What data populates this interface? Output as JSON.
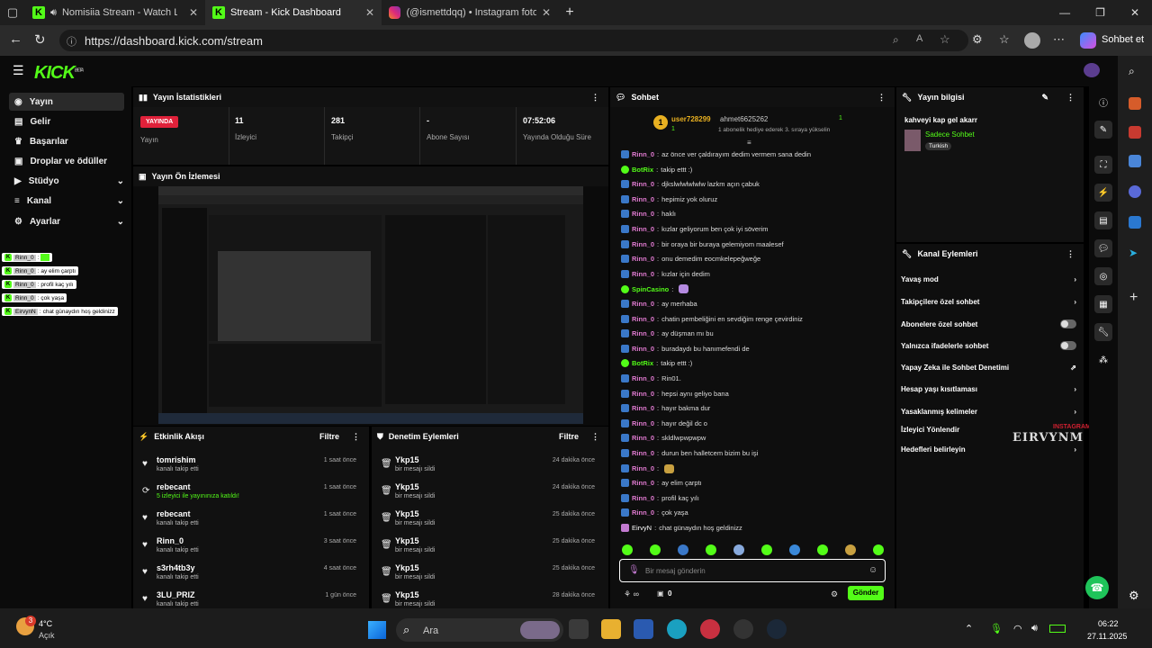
{
  "browser": {
    "tabs": [
      {
        "title": "Nomisiia Stream - Watch Liv",
        "active": false
      },
      {
        "title": "Stream - Kick Dashboard",
        "active": true
      },
      {
        "title": "(@ismettdqq) • Instagram fotoğra",
        "active": false
      }
    ],
    "url": "https://dashboard.kick.com/stream",
    "copilot_label": "Sohbet et"
  },
  "app": {
    "logo": "KICK",
    "logo_sup": "BETA"
  },
  "sidebar": {
    "items": [
      {
        "label": "Yayın",
        "icon": "broadcast-icon",
        "active": true
      },
      {
        "label": "Gelir",
        "icon": "money-icon"
      },
      {
        "label": "Başarılar",
        "icon": "trophy-icon"
      },
      {
        "label": "Droplar ve ödüller",
        "icon": "gift-icon"
      },
      {
        "label": "Stüdyo",
        "icon": "video-icon",
        "expand": true
      },
      {
        "label": "Kanal",
        "icon": "list-icon",
        "expand": true
      },
      {
        "label": "Ayarlar",
        "icon": "gear-icon",
        "expand": true
      }
    ],
    "overlay_chat": [
      {
        "user": "Rinn_0",
        "text": ""
      },
      {
        "user": "Rinn_0",
        "text": "ay elim çarptı"
      },
      {
        "user": "Rinn_0",
        "text": "profil kaç yılı"
      },
      {
        "user": "Rinn_0",
        "text": "çok yaşa"
      },
      {
        "user": "EirvynN",
        "text": "chat günaydın hoş geldinizz"
      }
    ]
  },
  "stats": {
    "title": "Yayın İstatistikleri",
    "live_badge": "YAYINDA",
    "live_label": "Yayın",
    "items": [
      {
        "value": "11",
        "label": "İzleyici"
      },
      {
        "value": "281",
        "label": "Takipçi"
      },
      {
        "value": "-",
        "label": "Abone Sayısı"
      },
      {
        "value": "07:52:06",
        "label": "Yayında Olduğu Süre"
      }
    ]
  },
  "preview": {
    "title": "Yayın Ön İzlemesi"
  },
  "activity": {
    "title": "Etkinlik Akışı",
    "filter": "Filtre",
    "events": [
      {
        "name": "tomrishim",
        "sub": "kanalı takip etti",
        "time": "1 saat önce",
        "icon": "heart-icon"
      },
      {
        "name": "rebecant",
        "sub": "5 izleyici ile yayınınıza katıldı!",
        "time": "1 saat önce",
        "icon": "raid-icon"
      },
      {
        "name": "rebecant",
        "sub": "kanalı takip etti",
        "time": "1 saat önce",
        "icon": "heart-icon"
      },
      {
        "name": "Rinn_0",
        "sub": "kanalı takip etti",
        "time": "3 saat önce",
        "icon": "heart-icon"
      },
      {
        "name": "s3rh4tb3y",
        "sub": "kanalı takip etti",
        "time": "4 saat önce",
        "icon": "heart-icon"
      },
      {
        "name": "3LU_PRIZ",
        "sub": "kanalı takip etti",
        "time": "1 gün önce",
        "icon": "heart-icon"
      }
    ]
  },
  "moderation": {
    "title": "Denetim Eylemleri",
    "filter": "Filtre",
    "events": [
      {
        "name": "Ykp15",
        "sub": "bir mesajı sildi",
        "time": "24 dakika önce"
      },
      {
        "name": "Ykp15",
        "sub": "bir mesajı sildi",
        "time": "24 dakika önce"
      },
      {
        "name": "Ykp15",
        "sub": "bir mesajı sildi",
        "time": "25 dakika önce"
      },
      {
        "name": "Ykp15",
        "sub": "bir mesajı sildi",
        "time": "25 dakika önce"
      },
      {
        "name": "Ykp15",
        "sub": "bir mesajı sildi",
        "time": "25 dakika önce"
      },
      {
        "name": "Ykp15",
        "sub": "bir mesajı sildi",
        "time": "28 dakika önce"
      }
    ]
  },
  "chat": {
    "title": "Sohbet",
    "pinned_user": "user728299",
    "pinned_count": "1",
    "pinned_other": "ahmet6625262",
    "pinned_other_count": "1",
    "gift_note": "1 abonelik hediye ederek 3. sıraya yükselin",
    "messages": [
      {
        "user": "Rinn_0",
        "text": "az önce ver çaldırayım dedim vermem sana dedin",
        "kind": "pink"
      },
      {
        "user": "BotRix",
        "text": "takip ettt :)",
        "kind": "green"
      },
      {
        "user": "Rinn_0",
        "text": "djkslwlwlwlwlw lazkm açın çabuk",
        "kind": "pink"
      },
      {
        "user": "Rinn_0",
        "text": "hepimiz yok oluruz",
        "kind": "pink"
      },
      {
        "user": "Rinn_0",
        "text": "haklı",
        "kind": "pink"
      },
      {
        "user": "Rinn_0",
        "text": "kızlar geliyorum ben çok iyi söverim",
        "kind": "pink"
      },
      {
        "user": "Rinn_0",
        "text": "bir oraya bir buraya gelemiyom maalesef",
        "kind": "pink"
      },
      {
        "user": "Rinn_0",
        "text": "onu demedim eocmkelepeğweğe",
        "kind": "pink"
      },
      {
        "user": "Rinn_0",
        "text": "kızlar için dedim",
        "kind": "pink"
      },
      {
        "user": "SpinCasino",
        "text": "",
        "kind": "green"
      },
      {
        "user": "Rinn_0",
        "text": "ay merhaba",
        "kind": "pink"
      },
      {
        "user": "Rinn_0",
        "text": "chatin pembeliğini en sevdiğim renge çevirdiniz",
        "kind": "pink"
      },
      {
        "user": "Rinn_0",
        "text": "ay düşman mı bu",
        "kind": "pink"
      },
      {
        "user": "Rinn_0",
        "text": "buradaydı bu hanımefendi de",
        "kind": "pink"
      },
      {
        "user": "BotRix",
        "text": "takip ettt :)",
        "kind": "green"
      },
      {
        "user": "Rinn_0",
        "text": "Rin01.",
        "kind": "pink"
      },
      {
        "user": "Rinn_0",
        "text": "hepsi aynı geliyo bana",
        "kind": "pink"
      },
      {
        "user": "Rinn_0",
        "text": "hayır bakma dur",
        "kind": "pink"
      },
      {
        "user": "Rinn_0",
        "text": "hayır değil dc o",
        "kind": "pink"
      },
      {
        "user": "Rinn_0",
        "text": "skldlwpwpwpw",
        "kind": "pink"
      },
      {
        "user": "Rinn_0",
        "text": "durun ben halletcem bizim bu işi",
        "kind": "pink"
      },
      {
        "user": "Rinn_0",
        "text": "",
        "kind": "pink"
      },
      {
        "user": "Rinn_0",
        "text": "ay elim çarptı",
        "kind": "pink"
      },
      {
        "user": "Rinn_0",
        "text": "profil kaç yılı",
        "kind": "pink"
      },
      {
        "user": "Rinn_0",
        "text": "çok yaşa",
        "kind": "pink"
      },
      {
        "user": "EirvyN",
        "text": "chat günaydın hoş geldinizz",
        "kind": "white"
      }
    ],
    "input_placeholder": "Bir mesaj gönderin",
    "points": "0",
    "send_label": "Gönder"
  },
  "info": {
    "title": "Yayın bilgisi",
    "stream_title": "kahveyi kap gel akarr",
    "category": "Sadece Sohbet",
    "tag": "Turkish"
  },
  "channel_actions": {
    "title": "Kanal Eylemleri",
    "items": [
      {
        "label": "Yavaş mod",
        "control": "chevron"
      },
      {
        "label": "Takipçilere özel sohbet",
        "control": "chevron"
      },
      {
        "label": "Abonelere özel sohbet",
        "control": "toggle"
      },
      {
        "label": "Yalnızca ifadelerle sohbet",
        "control": "toggle"
      },
      {
        "label": "Yapay Zeka ile Sohbet Denetimi",
        "control": "external"
      },
      {
        "label": "Hesap yaşı kısıtlaması",
        "control": "chevron"
      },
      {
        "label": "Yasaklanmış kelimeler",
        "control": "chevron"
      },
      {
        "label": "İzleyici Yönlendir",
        "control": "none"
      },
      {
        "label": "Hedefleri belirleyin",
        "control": "chevron"
      }
    ],
    "watermark_top": "INSTAGRAM",
    "watermark_main": "EIRVYNM"
  },
  "taskbar": {
    "weather_temp": "4°C",
    "weather_desc": "Açık",
    "weather_badge": "3",
    "search": "Ara",
    "time": "06:22",
    "date": "27.11.2025"
  },
  "colors": {
    "accent": "#53fc18",
    "live": "#e0213a",
    "chat_user": "#e07ad0"
  }
}
